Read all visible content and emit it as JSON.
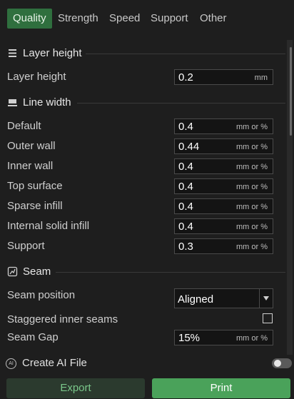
{
  "tabs": [
    "Quality",
    "Strength",
    "Speed",
    "Support",
    "Other"
  ],
  "active_tab": "Quality",
  "sections": {
    "layer_height": {
      "title": "Layer height",
      "fields": [
        {
          "label": "Layer height",
          "value": "0.2",
          "unit": "mm"
        }
      ]
    },
    "line_width": {
      "title": "Line width",
      "fields": [
        {
          "label": "Default",
          "value": "0.4",
          "unit": "mm or %"
        },
        {
          "label": "Outer wall",
          "value": "0.44",
          "unit": "mm or %"
        },
        {
          "label": "Inner wall",
          "value": "0.4",
          "unit": "mm or %"
        },
        {
          "label": "Top surface",
          "value": "0.4",
          "unit": "mm or %"
        },
        {
          "label": "Sparse infill",
          "value": "0.4",
          "unit": "mm or %"
        },
        {
          "label": "Internal solid infill",
          "value": "0.4",
          "unit": "mm or %"
        },
        {
          "label": "Support",
          "value": "0.3",
          "unit": "mm or %"
        }
      ]
    },
    "seam": {
      "title": "Seam",
      "seam_position": {
        "label": "Seam position",
        "selected": "Aligned"
      },
      "staggered_inner_seams": {
        "label": "Staggered inner seams",
        "checked": false
      },
      "seam_gap": {
        "label": "Seam Gap",
        "value": "15%",
        "unit": "mm or %"
      }
    }
  },
  "create_ai_file": {
    "label": "Create AI File",
    "icon_text": "AI",
    "enabled": false
  },
  "actions": {
    "export": "Export",
    "print": "Print"
  },
  "colors": {
    "accent": "#4aa25a",
    "tab_active_bg": "#2f6f3e",
    "background": "#1e1e1e"
  }
}
